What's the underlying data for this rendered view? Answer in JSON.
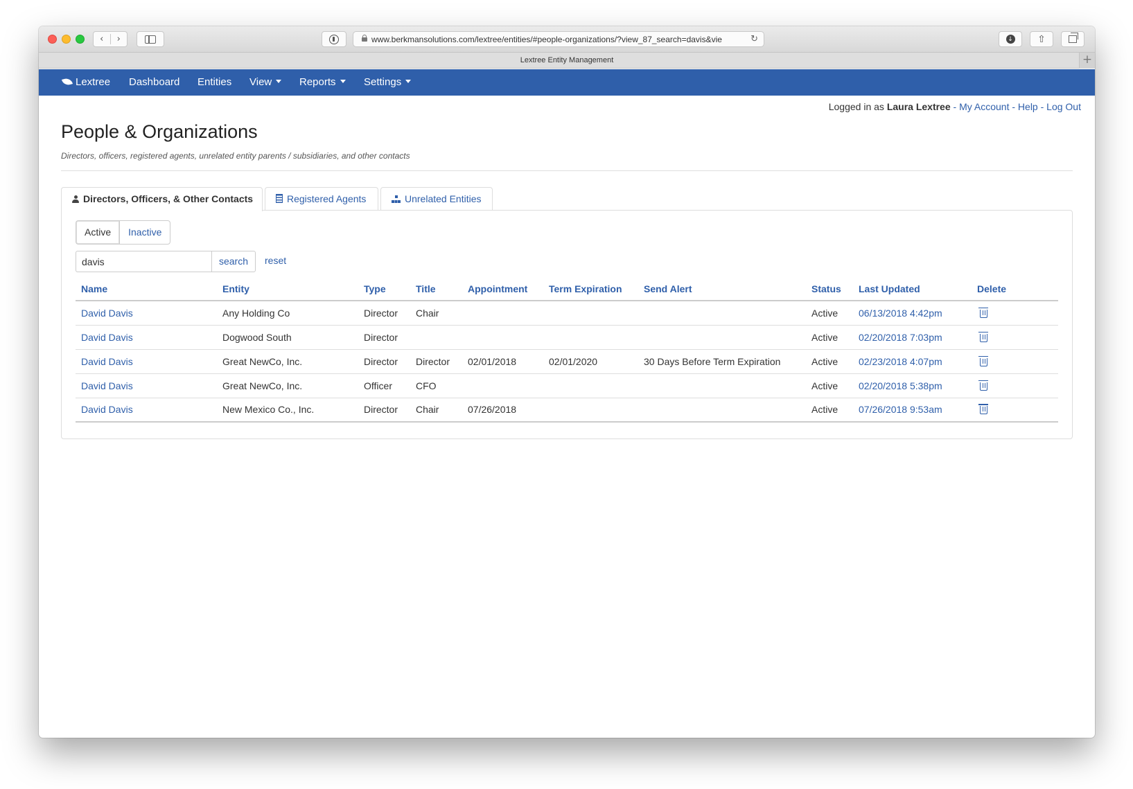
{
  "browser": {
    "url": "www.berkmansolutions.com/lextree/entities/#people-organizations/?view_87_search=davis&vie",
    "tab_title": "Lextree Entity Management"
  },
  "nav": {
    "brand": "Lextree",
    "items": [
      "Dashboard",
      "Entities",
      "View",
      "Reports",
      "Settings"
    ]
  },
  "user": {
    "prefix": "Logged in as",
    "name": "Laura Lextree",
    "sep": "-",
    "my_account": "My Account",
    "help": "Help",
    "logout": "Log Out"
  },
  "page": {
    "title": "People & Organizations",
    "subtitle": "Directors, officers, registered agents, unrelated entity parents / subsidiaries, and other contacts"
  },
  "tabs": [
    {
      "label": "Directors, Officers, & Other Contacts",
      "icon": "person-icon"
    },
    {
      "label": "Registered Agents",
      "icon": "building-icon"
    },
    {
      "label": "Unrelated Entities",
      "icon": "org-chart-icon"
    }
  ],
  "filter": {
    "active": "Active",
    "inactive": "Inactive"
  },
  "search": {
    "value": "davis",
    "button": "search",
    "reset": "reset"
  },
  "table": {
    "columns": [
      "Name",
      "Entity",
      "Type",
      "Title",
      "Appointment",
      "Term Expiration",
      "Send Alert",
      "Status",
      "Last Updated",
      "Delete"
    ],
    "rows": [
      {
        "name": "David Davis",
        "entity": "Any Holding Co",
        "type": "Director",
        "title": "Chair",
        "appointment": "",
        "term": "",
        "alert": "",
        "status": "Active",
        "updated": "06/13/2018 4:42pm"
      },
      {
        "name": "David Davis",
        "entity": "Dogwood South",
        "type": "Director",
        "title": "",
        "appointment": "",
        "term": "",
        "alert": "",
        "status": "Active",
        "updated": "02/20/2018 7:03pm"
      },
      {
        "name": "David Davis",
        "entity": "Great NewCo, Inc.",
        "type": "Director",
        "title": "Director",
        "appointment": "02/01/2018",
        "term": "02/01/2020",
        "alert": "30 Days Before Term Expiration",
        "status": "Active",
        "updated": "02/23/2018 4:07pm"
      },
      {
        "name": "David Davis",
        "entity": "Great NewCo, Inc.",
        "type": "Officer",
        "title": "CFO",
        "appointment": "",
        "term": "",
        "alert": "",
        "status": "Active",
        "updated": "02/20/2018 5:38pm"
      },
      {
        "name": "David Davis",
        "entity": "New Mexico Co., Inc.",
        "type": "Director",
        "title": "Chair",
        "appointment": "07/26/2018",
        "term": "",
        "alert": "",
        "status": "Active",
        "updated": "07/26/2018 9:53am"
      }
    ]
  }
}
